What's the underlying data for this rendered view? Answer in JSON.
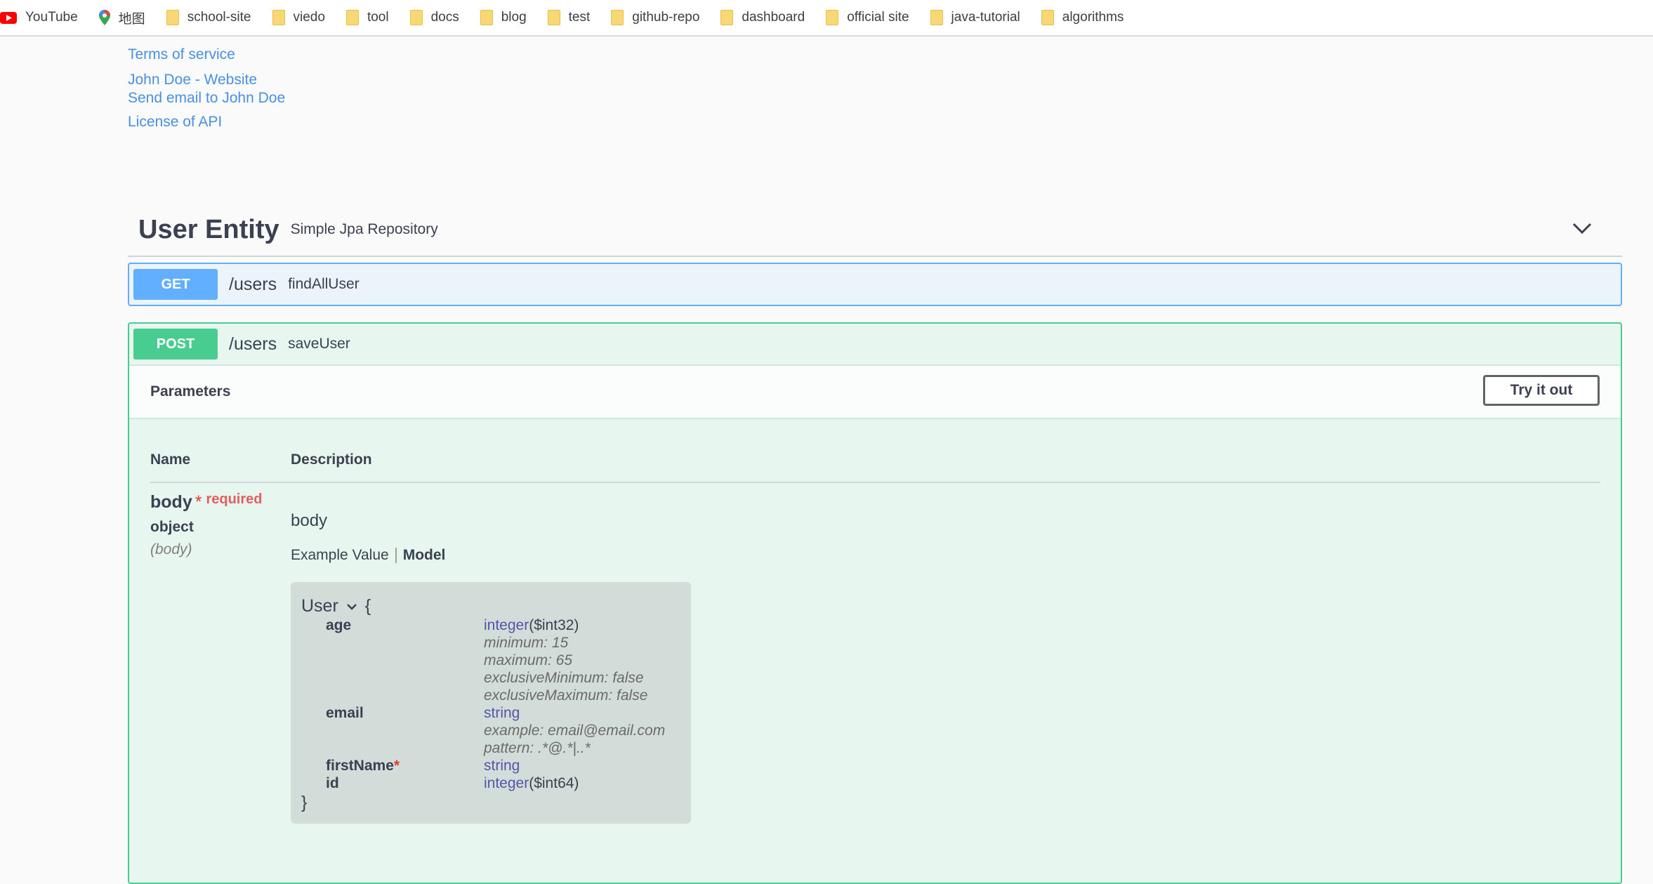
{
  "bookmarks": [
    {
      "label": "YouTube",
      "icon": "youtube-icon"
    },
    {
      "label": "地图",
      "icon": "maps-icon"
    },
    {
      "label": "school-site",
      "icon": "folder-icon"
    },
    {
      "label": "viedo",
      "icon": "folder-icon"
    },
    {
      "label": "tool",
      "icon": "folder-icon"
    },
    {
      "label": "docs",
      "icon": "folder-icon"
    },
    {
      "label": "blog",
      "icon": "folder-icon"
    },
    {
      "label": "test",
      "icon": "folder-icon"
    },
    {
      "label": "github-repo",
      "icon": "folder-icon"
    },
    {
      "label": "dashboard",
      "icon": "folder-icon"
    },
    {
      "label": "official site",
      "icon": "folder-icon"
    },
    {
      "label": "java-tutorial",
      "icon": "folder-icon"
    },
    {
      "label": "algorithms",
      "icon": "folder-icon"
    }
  ],
  "info": {
    "terms": "Terms of service",
    "website": "John Doe - Website",
    "email": "Send email to John Doe",
    "license": "License of API"
  },
  "tag": {
    "title": "User Entity",
    "description": "Simple Jpa Repository"
  },
  "operations": [
    {
      "method": "GET",
      "path": "/users",
      "summary": "findAllUser",
      "color": "#61affe"
    },
    {
      "method": "POST",
      "path": "/users",
      "summary": "saveUser",
      "color": "#49cc90"
    }
  ],
  "post_details": {
    "parameters_title": "Parameters",
    "try_button": "Try it out",
    "col_name": "Name",
    "col_description": "Description",
    "param": {
      "name": "body",
      "star": "*",
      "required": "required",
      "type": "object",
      "in": "(body)",
      "description": "body"
    },
    "tab_example": "Example Value",
    "tab_model": "Model",
    "model": {
      "name": "User",
      "open_brace": "{",
      "close_brace": "}",
      "props": {
        "age": {
          "name": "age",
          "type": "integer",
          "format": "($int32)",
          "minimum": "minimum: 15",
          "maximum": "maximum: 65",
          "exMin": "exclusiveMinimum: false",
          "exMax": "exclusiveMaximum: false"
        },
        "email": {
          "name": "email",
          "type": "string",
          "example": "example: email@email.com",
          "pattern": "pattern: .*@.*|..*"
        },
        "firstName": {
          "name": "firstName",
          "star": "*",
          "type": "string"
        },
        "id": {
          "name": "id",
          "type": "integer",
          "format": "($int64)"
        }
      }
    }
  }
}
